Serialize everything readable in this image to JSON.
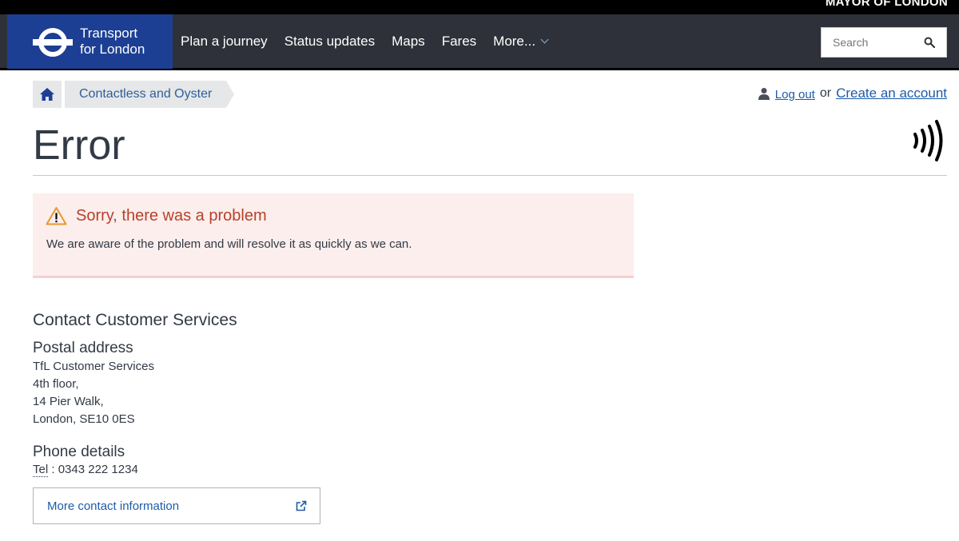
{
  "mayor_bar": {
    "text": "MAYOR OF LONDON"
  },
  "header": {
    "logo_line1": "Transport",
    "logo_line2": "for London",
    "nav": [
      {
        "label": "Plan a journey"
      },
      {
        "label": "Status updates"
      },
      {
        "label": "Maps"
      },
      {
        "label": "Fares"
      },
      {
        "label": "More..."
      }
    ],
    "search": {
      "placeholder": "Search",
      "value": "",
      "icon": "search-icon"
    }
  },
  "breadcrumb": {
    "home_icon": "home-icon",
    "items": [
      {
        "label": "Contactless and Oyster"
      }
    ]
  },
  "account": {
    "user_icon": "user-icon",
    "logout": "Log out",
    "or": "or",
    "create": "Create an account"
  },
  "page": {
    "title": "Error",
    "contactless_icon": "contactless-icon"
  },
  "alert": {
    "icon": "warning-icon",
    "title": "Sorry, there was a problem",
    "body": "We are aware of the problem and will resolve it as quickly as we can."
  },
  "contact": {
    "heading": "Contact Customer Services",
    "postal_heading": "Postal address",
    "address": [
      "TfL Customer Services",
      "4th floor,",
      "14 Pier Walk,",
      "London, SE10 0ES"
    ],
    "phone_heading": "Phone details",
    "tel_label": "Tel",
    "tel_sep": ":",
    "tel_number": "0343 222 1234",
    "more_link": "More contact information",
    "external_icon": "external-link-icon"
  },
  "colors": {
    "header_bg": "#2e3139",
    "logo_bg": "#1c3f94",
    "link": "#1c5ca8",
    "alert_bg": "#fbeeed",
    "alert_title": "#b8412a"
  }
}
